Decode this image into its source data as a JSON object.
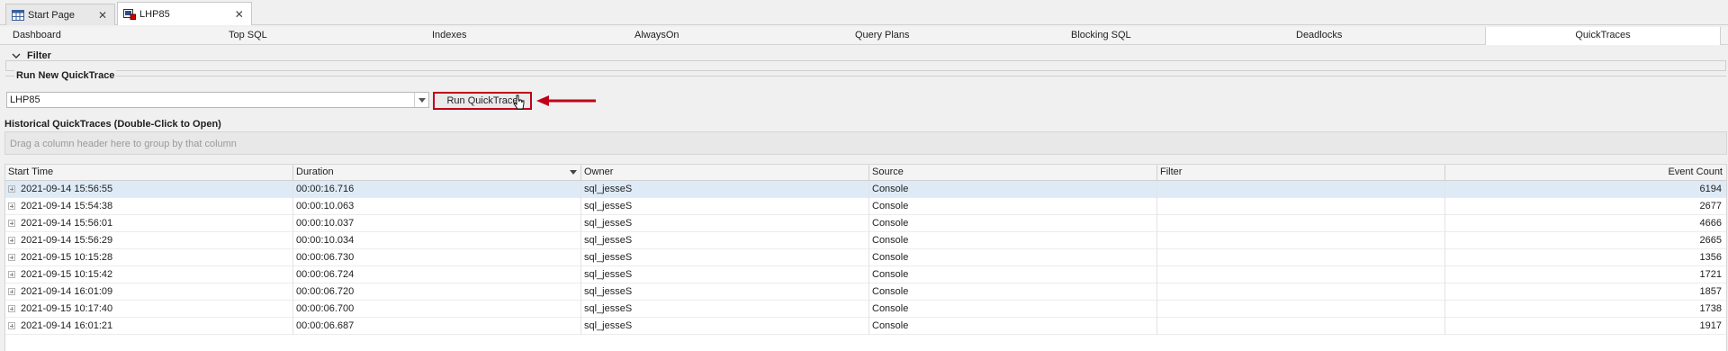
{
  "doc_tabs": [
    {
      "label": "Start Page",
      "icon": "table-icon"
    },
    {
      "label": "LHP85",
      "icon": "server-icon"
    }
  ],
  "feature_tabs": [
    {
      "label": "Dashboard"
    },
    {
      "label": "Top SQL"
    },
    {
      "label": "Indexes"
    },
    {
      "label": "AlwaysOn"
    },
    {
      "label": "Query Plans"
    },
    {
      "label": "Blocking SQL"
    },
    {
      "label": "Deadlocks"
    },
    {
      "label": "QuickTraces"
    }
  ],
  "active_tab": "QuickTraces",
  "filter": {
    "label": "Filter"
  },
  "run_new": {
    "group_label": "Run New QuickTrace",
    "server_value": "LHP85",
    "run_button": "Run QuickTrace"
  },
  "historical": {
    "label": "Historical QuickTraces (Double-Click to Open)",
    "group_hint": "Drag a column header here to group by that column",
    "columns": [
      "Start Time",
      "Duration",
      "Owner",
      "Source",
      "Filter",
      "Event Count"
    ],
    "rows": [
      {
        "start": "2021-09-14 15:56:55",
        "duration": "00:00:16.716",
        "owner": "sql_jesseS",
        "source": "Console",
        "filter": "",
        "count": "6194"
      },
      {
        "start": "2021-09-14 15:54:38",
        "duration": "00:00:10.063",
        "owner": "sql_jesseS",
        "source": "Console",
        "filter": "",
        "count": "2677"
      },
      {
        "start": "2021-09-14 15:56:01",
        "duration": "00:00:10.037",
        "owner": "sql_jesseS",
        "source": "Console",
        "filter": "",
        "count": "4666"
      },
      {
        "start": "2021-09-14 15:56:29",
        "duration": "00:00:10.034",
        "owner": "sql_jesseS",
        "source": "Console",
        "filter": "",
        "count": "2665"
      },
      {
        "start": "2021-09-15 10:15:28",
        "duration": "00:00:06.730",
        "owner": "sql_jesseS",
        "source": "Console",
        "filter": "",
        "count": "1356"
      },
      {
        "start": "2021-09-15 10:15:42",
        "duration": "00:00:06.724",
        "owner": "sql_jesseS",
        "source": "Console",
        "filter": "",
        "count": "1721"
      },
      {
        "start": "2021-09-14 16:01:09",
        "duration": "00:00:06.720",
        "owner": "sql_jesseS",
        "source": "Console",
        "filter": "",
        "count": "1857"
      },
      {
        "start": "2021-09-15 10:17:40",
        "duration": "00:00:06.700",
        "owner": "sql_jesseS",
        "source": "Console",
        "filter": "",
        "count": "1738"
      },
      {
        "start": "2021-09-14 16:01:21",
        "duration": "00:00:06.687",
        "owner": "sql_jesseS",
        "source": "Console",
        "filter": "",
        "count": "1917"
      }
    ]
  },
  "colors": {
    "highlight": "#c0001a",
    "selected_row": "#deebf7"
  }
}
